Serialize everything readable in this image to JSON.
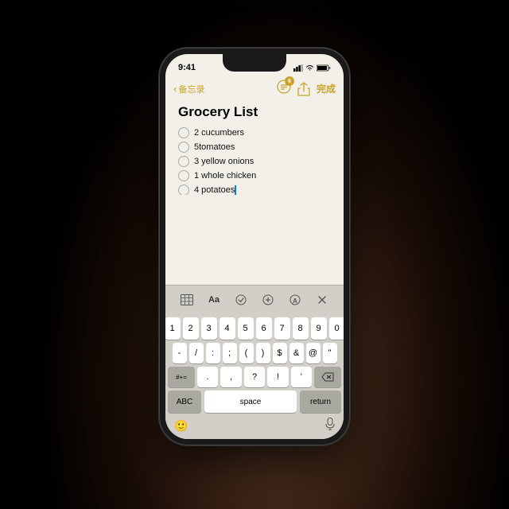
{
  "status": {
    "time": "9:41",
    "signal": "▲▲▲",
    "wifi": "WiFi",
    "battery": "🔋"
  },
  "nav": {
    "back_label": "备忘录",
    "done_label": "完成",
    "badge_count": "6"
  },
  "note": {
    "title": "Grocery List",
    "items": [
      {
        "id": 1,
        "text": "2 cucumbers",
        "checked": false
      },
      {
        "id": 2,
        "text": "5tomatoes",
        "checked": false
      },
      {
        "id": 3,
        "text": "3 yellow onions",
        "checked": false
      },
      {
        "id": 4,
        "text": "1 whole chicken",
        "checked": false
      },
      {
        "id": 5,
        "text": "4 potatoes",
        "checked": false,
        "cursor": true
      }
    ]
  },
  "toolbar": {
    "icons": [
      "grid",
      "Aa",
      "✓",
      "+",
      "A",
      "✕"
    ]
  },
  "keyboard": {
    "row1": [
      "1",
      "2",
      "3",
      "4",
      "5",
      "6",
      "7",
      "8",
      "9",
      "0"
    ],
    "row2": [
      "-",
      "/",
      ":",
      ";",
      "(",
      ")",
      "$",
      "&",
      "@",
      "\""
    ],
    "row3_left": [
      "#+= "
    ],
    "row3_mid": [
      ".",
      "  ,",
      "?",
      "!",
      "'"
    ],
    "row3_right": [
      "⌫"
    ],
    "bottom": [
      "ABC",
      "space",
      "return"
    ]
  }
}
